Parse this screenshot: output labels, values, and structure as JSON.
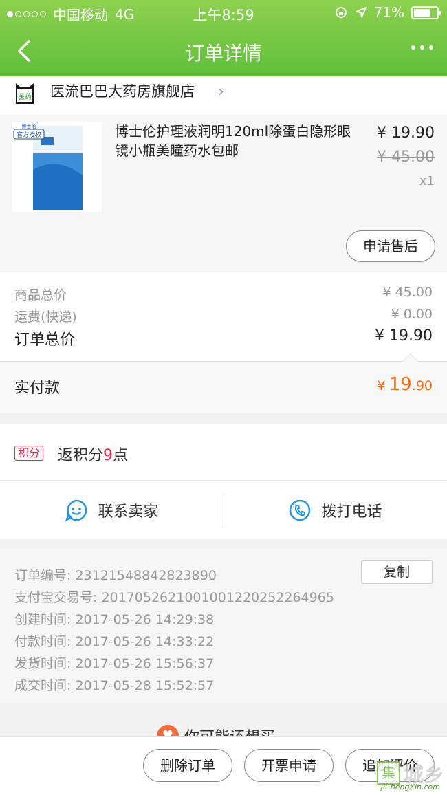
{
  "status_bar": {
    "carrier": "中国移动",
    "network": "4G",
    "time": "上午8:59",
    "battery_text": "71%",
    "battery_level": 0.71
  },
  "nav": {
    "title": "订单详情"
  },
  "store": {
    "name": "医流巴巴大药房旗舰店",
    "logo_text": "医药"
  },
  "product": {
    "badge": "官方授权",
    "brand_small": "博士伦",
    "title": "博士伦护理液润明120ml除蛋白隐形眼镜小瓶美瞳药水包邮",
    "price": "¥ 19.90",
    "original_price": "¥ 45.00",
    "quantity": "x1",
    "after_sale_label": "申请售后"
  },
  "totals": {
    "goods_label": "商品总价",
    "goods_value": "¥ 45.00",
    "shipping_label": "运费(快递)",
    "shipping_value": "¥ 0.00",
    "order_label": "订单总价",
    "order_value": "¥ 19.90"
  },
  "paid": {
    "label": "实付款",
    "currency": "¥",
    "integer": "19",
    "decimal": ".90"
  },
  "points": {
    "tag": "积分",
    "prefix": "返积分",
    "count": "9",
    "suffix": "点"
  },
  "contact": {
    "seller_label": "联系卖家",
    "phone_label": "拨打电话"
  },
  "order_info": {
    "copy_label": "复制",
    "lines": [
      "订单编号:  23121548842823890",
      "支付宝交易号:  2017052621001001220252264965",
      "创建时间:  2017-05-26 14:29:38",
      "付款时间:  2017-05-26 14:33:22",
      "发货时间:  2017-05-26 15:56:37",
      "成交时间:  2017-05-28 15:52:57"
    ]
  },
  "recommend": {
    "text": "你可能还想买"
  },
  "bottom": {
    "delete_label": "删除订单",
    "invoice_label": "开票申请",
    "review_label": "追加评价"
  },
  "watermark": {
    "box": "集",
    "text": "城乡",
    "sub": "JiChengXin.com"
  },
  "colors": {
    "nav_green": "#5fbf3a",
    "accent_orange": "#ff6a13",
    "points_red": "#e8264a",
    "icon_blue": "#2196d9"
  }
}
